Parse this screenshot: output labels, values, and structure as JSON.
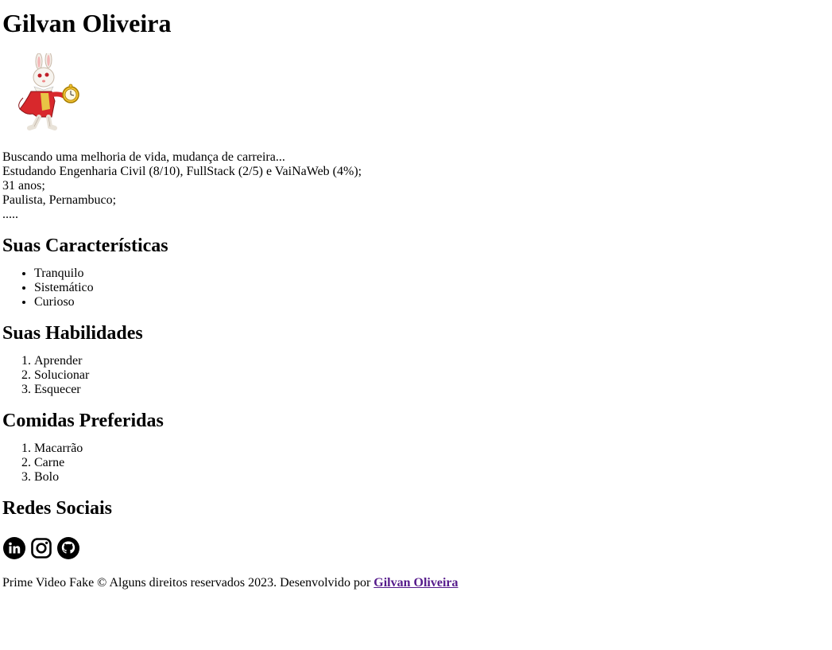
{
  "profile": {
    "name": "Gilvan Oliveira",
    "avatar_icon": "white-rabbit-with-pocket-watch",
    "bio": [
      "Buscando uma melhoria de vida, mudança de carreira...",
      "Estudando Engenharia Civil (8/10), FullStack (2/5) e VaiNaWeb (4%);",
      "31 anos;",
      "Paulista, Pernambuco;",
      "....."
    ]
  },
  "characteristics": {
    "heading": "Suas Características",
    "items": [
      "Tranquilo",
      "Sistemático",
      "Curioso"
    ]
  },
  "skills": {
    "heading": "Suas Habilidades",
    "items": [
      "Aprender",
      "Solucionar",
      "Esquecer"
    ]
  },
  "foods": {
    "heading": "Comidas Preferidas",
    "items": [
      "Macarrão",
      "Carne",
      "Bolo"
    ]
  },
  "social": {
    "heading": "Redes Sociais",
    "icons": [
      "linkedin-icon",
      "instagram-icon",
      "github-icon"
    ]
  },
  "footer": {
    "text": "Prime Video Fake © Alguns direitos reservados 2023. Desenvolvido por ",
    "link_label": "Gilvan Oliveira"
  }
}
